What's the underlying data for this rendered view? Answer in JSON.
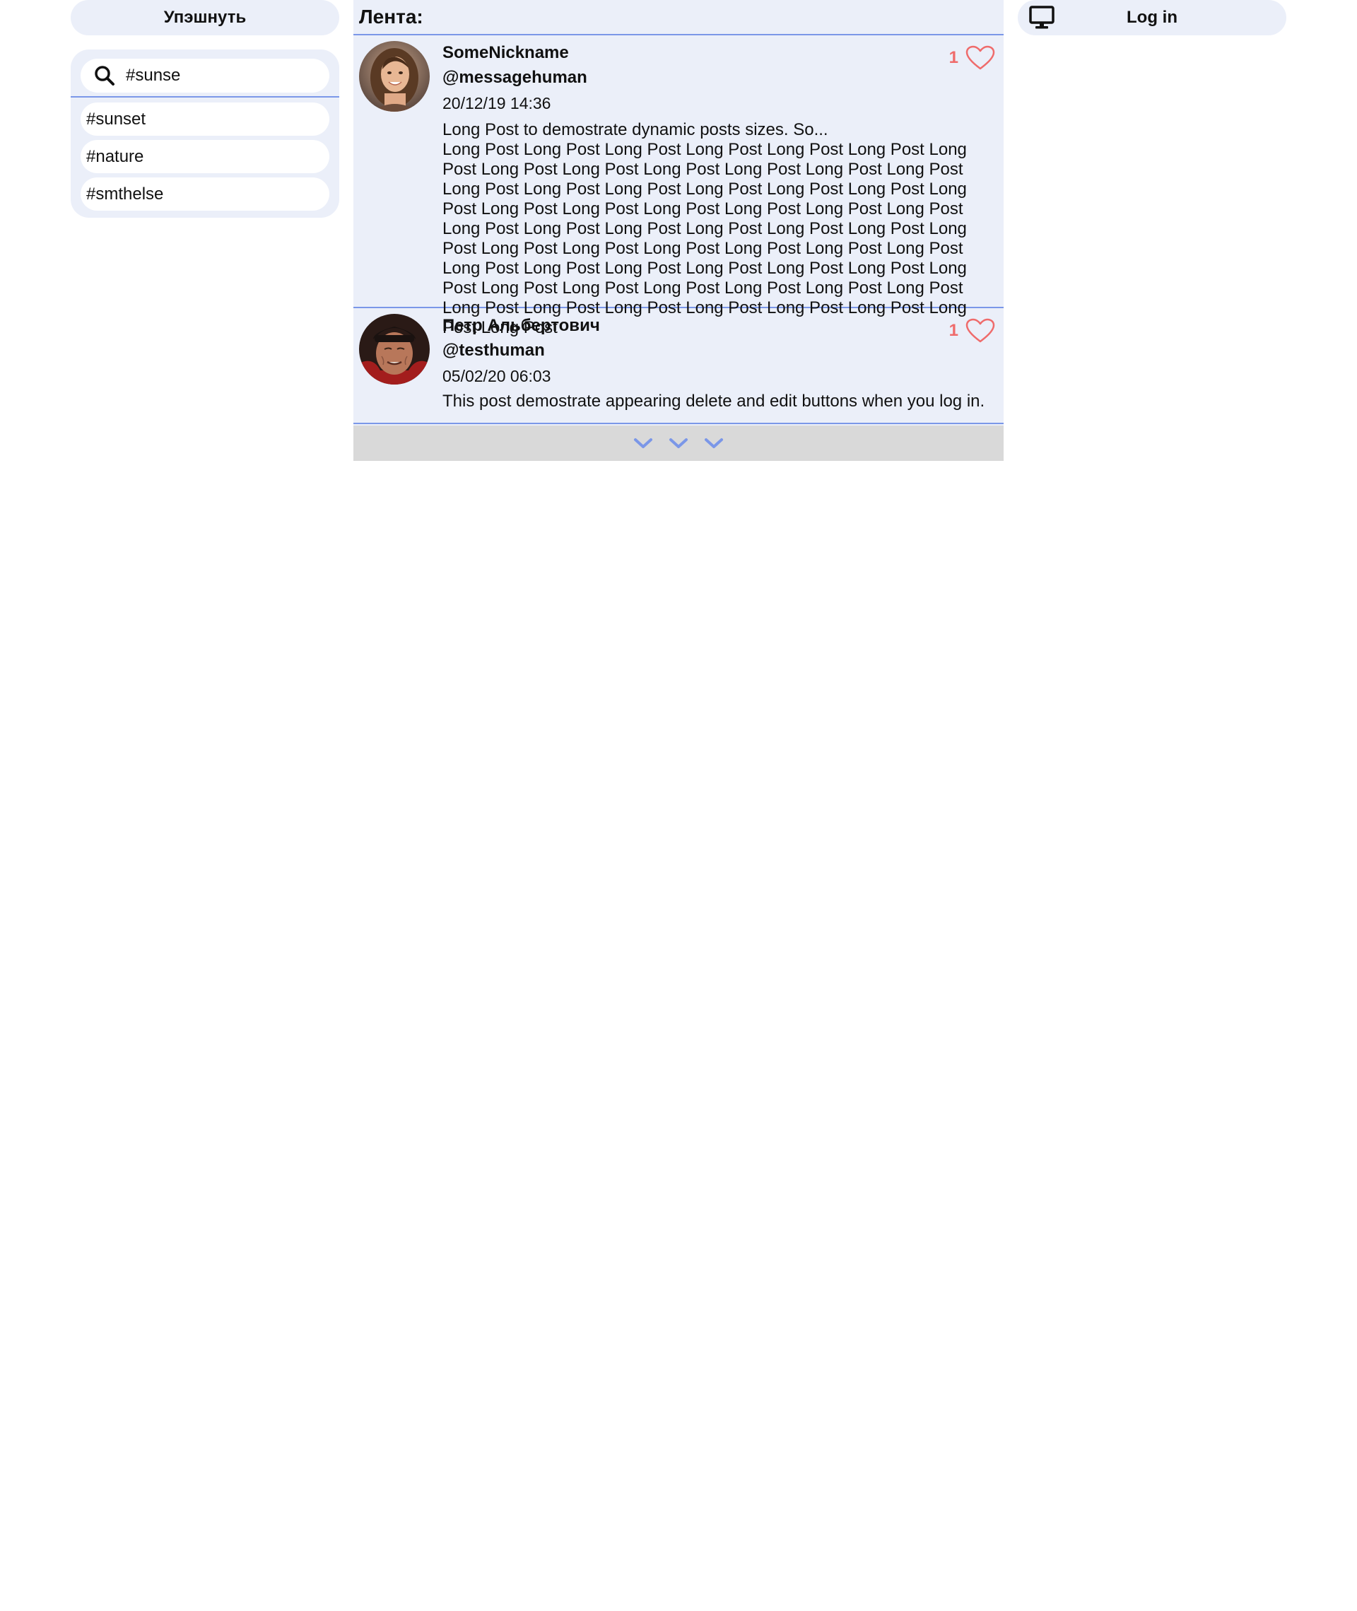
{
  "left": {
    "post_button_label": "Упэшнуть",
    "search": {
      "value": "#sunse",
      "placeholder": ""
    },
    "suggestions": [
      "#sunset",
      "#nature",
      "#smthelse"
    ]
  },
  "feed": {
    "title": "Лента:",
    "posts": [
      {
        "name": "SomeNickname",
        "handle": "@messagehuman",
        "date": "20/12/19 14:36",
        "likes": "1",
        "intro": "Long Post to demostrate dynamic posts sizes. So...",
        "body": "Long Post Long Post Long Post Long Post Long Post Long Post Long Post Long Post Long Post Long Post Long Post Long Post Long Post Long Post Long Post Long Post Long Post Long Post Long Post Long Post Long Post Long Post Long Post Long Post Long Post Long Post Long Post Long Post Long Post Long Post Long Post Long Post Long Post Long Post Long Post Long Post Long Post Long Post Long Post Long Post Long Post Long Post Long Post Long Post Long Post Long Post Long Post Long Post Long Post Long Post Long Post Long Post Long Post Long Post Long Post Long Post Long Post Long Post Long Post Long Post"
      },
      {
        "name": "Петр Альбертович",
        "handle": "@testhuman",
        "date": "05/02/20 06:03",
        "likes": "1",
        "intro": "",
        "body": "This post demostrate appearing delete and edit buttons when you log in."
      }
    ],
    "load_more_icons": [
      "chevron-down-icon",
      "chevron-down-icon",
      "chevron-down-icon"
    ]
  },
  "right": {
    "login_label": "Log in",
    "login_icon": "monitor-icon"
  },
  "colors": {
    "panel": "#ebeff9",
    "accent": "#7b97e8",
    "like": "#ef6b6b",
    "load_more_bg": "#d9d9d9"
  }
}
